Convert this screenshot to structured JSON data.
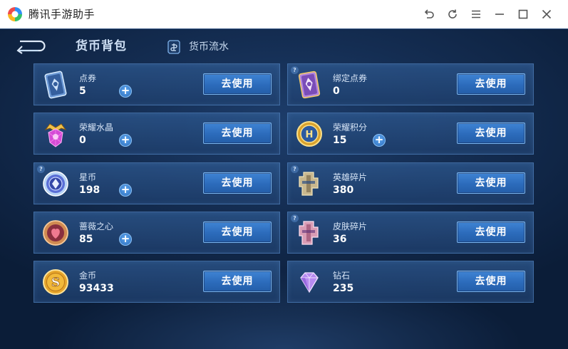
{
  "window": {
    "title": "腾讯手游助手",
    "controls": [
      "undo-icon",
      "refresh-icon",
      "menu-icon",
      "minimize-icon",
      "maximize-icon",
      "close-icon"
    ]
  },
  "header": {
    "title": "货币背包",
    "flow_label": "货币流水"
  },
  "use_label": "去使用",
  "plus_label": "+",
  "info_label": "?",
  "currencies": [
    {
      "name": "点券",
      "value": "5",
      "icon": "voucher-card-icon",
      "has_plus": true,
      "has_info": false
    },
    {
      "name": "绑定点券",
      "value": "0",
      "icon": "bound-voucher-card-icon",
      "has_plus": false,
      "has_info": true
    },
    {
      "name": "荣耀水晶",
      "value": "0",
      "icon": "glory-crystal-icon",
      "has_plus": true,
      "has_info": false
    },
    {
      "name": "荣耀积分",
      "value": "15",
      "icon": "glory-points-coin-icon",
      "has_plus": true,
      "has_info": false
    },
    {
      "name": "星币",
      "value": "198",
      "icon": "star-coin-icon",
      "has_plus": true,
      "has_info": true
    },
    {
      "name": "英雄碎片",
      "value": "380",
      "icon": "hero-fragment-icon",
      "has_plus": false,
      "has_info": true
    },
    {
      "name": "蔷薇之心",
      "value": "85",
      "icon": "rose-heart-icon",
      "has_plus": true,
      "has_info": false
    },
    {
      "name": "皮肤碎片",
      "value": "36",
      "icon": "skin-fragment-icon",
      "has_plus": false,
      "has_info": true
    },
    {
      "name": "金币",
      "value": "93433",
      "icon": "gold-coin-icon",
      "has_plus": false,
      "has_info": false
    },
    {
      "name": "钻石",
      "value": "235",
      "icon": "diamond-icon",
      "has_plus": false,
      "has_info": false
    }
  ],
  "colors": {
    "card_bg": "#26528a",
    "button": "#2f6fbf",
    "text_light": "#d6e4f6"
  }
}
